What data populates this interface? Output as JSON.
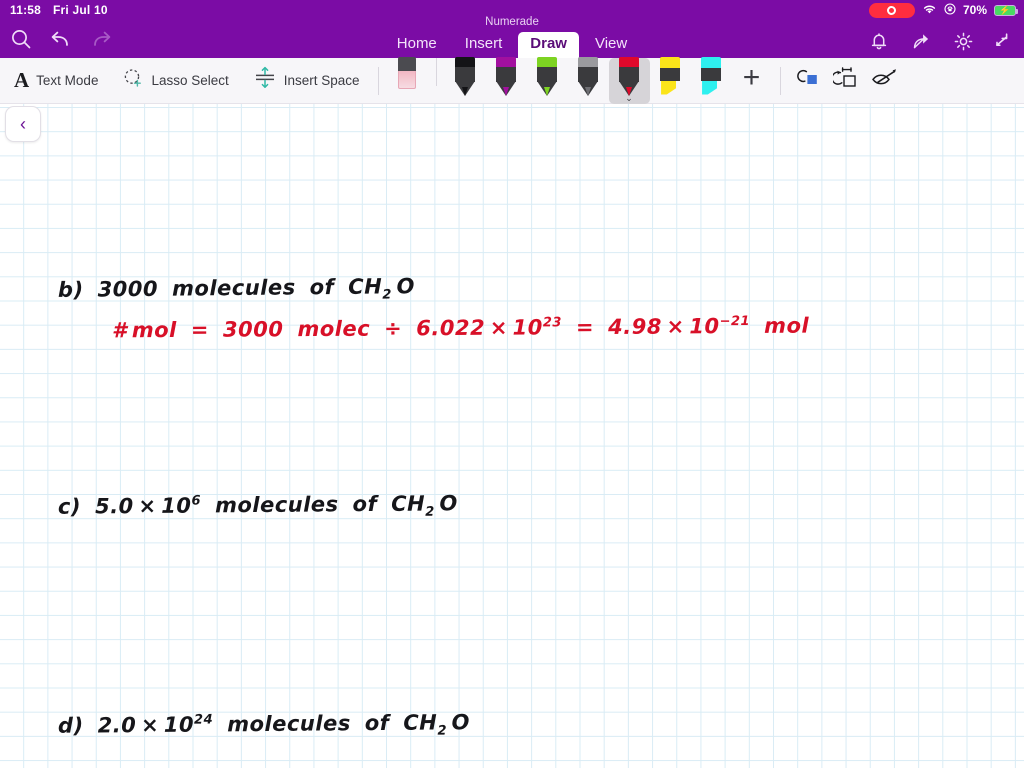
{
  "status_bar": {
    "time": "11:58",
    "date": "Fri Jul 10",
    "recording_label": "screen-recording-active",
    "wifi_icon": "wifi-icon",
    "lock_rotation_icon": "rotation-lock-icon",
    "battery_percent": "70%",
    "battery_icon": "battery-charging-icon"
  },
  "ribbon": {
    "doc_title": "Numerade",
    "search_icon": "search-icon",
    "undo_icon": "undo-icon",
    "redo_icon": "redo-icon",
    "tabs": [
      {
        "label": "Home",
        "active": false
      },
      {
        "label": "Insert",
        "active": false
      },
      {
        "label": "Draw",
        "active": true
      },
      {
        "label": "View",
        "active": false
      }
    ],
    "right_icons": [
      {
        "name": "bell-icon"
      },
      {
        "name": "share-icon"
      },
      {
        "name": "gear-icon"
      },
      {
        "name": "collapse-ribbon-icon"
      }
    ]
  },
  "toolbar": {
    "text_mode_label": "Text Mode",
    "text_mode_icon": "letter-a-icon",
    "lasso_label": "Lasso Select",
    "lasso_icon": "lasso-select-icon",
    "insert_space_label": "Insert Space",
    "insert_space_icon": "insert-space-icon",
    "pens": [
      {
        "name": "eraser",
        "type": "eraser",
        "color": "#f2b7c3",
        "selected": false
      },
      {
        "name": "pen-black",
        "type": "pen",
        "color": "#141417",
        "selected": false
      },
      {
        "name": "pen-magenta",
        "type": "pen",
        "color": "#a2109f",
        "selected": false
      },
      {
        "name": "pen-green",
        "type": "pen",
        "color": "#7dd322",
        "selected": false
      },
      {
        "name": "pen-gray",
        "type": "pen",
        "color": "#9a9a9e",
        "selected": false
      },
      {
        "name": "pen-red",
        "type": "pen",
        "color": "#e0092b",
        "selected": true
      },
      {
        "name": "highlighter-yellow",
        "type": "highlighter",
        "color": "#fbe41a",
        "selected": false
      },
      {
        "name": "highlighter-cyan",
        "type": "highlighter",
        "color": "#2ef0ef",
        "selected": false
      }
    ],
    "add_pen_label": "+",
    "ink_to_shape_icon": "ink-to-shape-icon",
    "ink_to_transform_icon": "ink-to-transform-icon",
    "ink_replay_icon": "ink-replay-icon",
    "selected_pen_chevron": "⌄"
  },
  "canvas": {
    "back_button_icon": "chevron-left-icon",
    "paper": "grid-paper",
    "grid_color": "#d9ecf5",
    "ink_colors": {
      "black": "#16161a",
      "red": "#d81028"
    },
    "notes": [
      {
        "id": "line-b",
        "color": "black",
        "text": "b) 3000 molecules of CH2O",
        "segments": [
          {
            "t": "b)"
          },
          {
            "gap": true
          },
          {
            "t": "3000"
          },
          {
            "gap": true
          },
          {
            "t": "molecules"
          },
          {
            "gap": true
          },
          {
            "t": "of"
          },
          {
            "gap": true
          },
          {
            "t": "CH"
          },
          {
            "sub": "2"
          },
          {
            "t": "O"
          }
        ]
      },
      {
        "id": "line-b2",
        "color": "red",
        "text": "# mol = 3000 molec ÷ 6.022 x 10^23 = 4.98 x 10^-21 mol",
        "segments": [
          {
            "t": "# mol"
          },
          {
            "gap": true
          },
          {
            "t": "="
          },
          {
            "gap": true
          },
          {
            "t": "3000"
          },
          {
            "gap": true
          },
          {
            "t": "molec"
          },
          {
            "gap": true
          },
          {
            "t": "÷"
          },
          {
            "gap": true
          },
          {
            "t": "6.022 × 10"
          },
          {
            "sup": "23"
          },
          {
            "gap": true
          },
          {
            "t": "="
          },
          {
            "gap": true
          },
          {
            "t": "4.98 × 10"
          },
          {
            "sup": "−21"
          },
          {
            "gap": true
          },
          {
            "t": "mol"
          }
        ]
      },
      {
        "id": "line-c",
        "color": "black",
        "text": "c) 5.0 x 10^6 molecules of CH2O",
        "segments": [
          {
            "t": "c)"
          },
          {
            "gap": true
          },
          {
            "t": "5.0 × 10"
          },
          {
            "sup": "6"
          },
          {
            "gap": true
          },
          {
            "t": "molecules"
          },
          {
            "gap": true
          },
          {
            "t": "of"
          },
          {
            "gap": true
          },
          {
            "t": "CH"
          },
          {
            "sub": "2"
          },
          {
            "t": "O"
          }
        ]
      },
      {
        "id": "line-d",
        "color": "black",
        "text": "d) 2.0 x 10^24 molecules of CH2O",
        "segments": [
          {
            "t": "d)"
          },
          {
            "gap": true
          },
          {
            "t": "2.0 × 10"
          },
          {
            "sup": "24"
          },
          {
            "gap": true
          },
          {
            "t": "molecules"
          },
          {
            "gap": true
          },
          {
            "t": "of"
          },
          {
            "gap": true
          },
          {
            "t": "CH"
          },
          {
            "sub": "2"
          },
          {
            "t": "O"
          }
        ]
      }
    ]
  }
}
